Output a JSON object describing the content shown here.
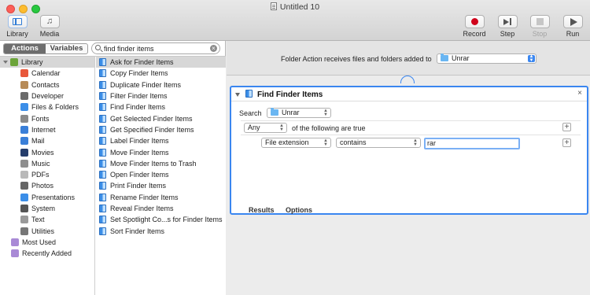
{
  "window": {
    "title": "Untitled 10"
  },
  "toolbar": {
    "library_label": "Library",
    "media_label": "Media",
    "record_label": "Record",
    "step_label": "Step",
    "stop_label": "Stop",
    "run_label": "Run"
  },
  "tabs": {
    "actions": "Actions",
    "variables": "Variables"
  },
  "search": {
    "value": "find finder items"
  },
  "library": [
    {
      "label": "Library",
      "icon": "library-icon",
      "color": "#6ca43a"
    },
    {
      "label": "Calendar",
      "icon": "calendar-icon",
      "color": "#e8583b"
    },
    {
      "label": "Contacts",
      "icon": "contacts-icon",
      "color": "#b78b57"
    },
    {
      "label": "Developer",
      "icon": "developer-icon",
      "color": "#6b6b6b"
    },
    {
      "label": "Files & Folders",
      "icon": "finder-icon",
      "color": "#3b8ee8"
    },
    {
      "label": "Fonts",
      "icon": "fonts-icon",
      "color": "#8a8a8a"
    },
    {
      "label": "Internet",
      "icon": "internet-icon",
      "color": "#3a7fd8"
    },
    {
      "label": "Mail",
      "icon": "mail-icon",
      "color": "#3a7fd8"
    },
    {
      "label": "Movies",
      "icon": "movies-icon",
      "color": "#253d6b"
    },
    {
      "label": "Music",
      "icon": "music-icon",
      "color": "#8f8f8f"
    },
    {
      "label": "PDFs",
      "icon": "pdf-icon",
      "color": "#b9b9b9"
    },
    {
      "label": "Photos",
      "icon": "photos-icon",
      "color": "#666666"
    },
    {
      "label": "Presentations",
      "icon": "presentations-icon",
      "color": "#3b8ee8"
    },
    {
      "label": "System",
      "icon": "system-icon",
      "color": "#555555"
    },
    {
      "label": "Text",
      "icon": "text-icon",
      "color": "#9a9a9a"
    },
    {
      "label": "Utilities",
      "icon": "utilities-icon",
      "color": "#777777"
    },
    {
      "label": "Most Used",
      "icon": "smart-folder-icon",
      "color": "#a98ad6"
    },
    {
      "label": "Recently Added",
      "icon": "smart-folder-icon",
      "color": "#a98ad6"
    }
  ],
  "actions": [
    "Ask for Finder Items",
    "Copy Finder Items",
    "Duplicate Finder Items",
    "Filter Finder Items",
    "Find Finder Items",
    "Get Selected Finder Items",
    "Get Specified Finder Items",
    "Label Finder Items",
    "Move Finder Items",
    "Move Finder Items to Trash",
    "Open Finder Items",
    "Print Finder Items",
    "Rename Finder Items",
    "Reveal Finder Items",
    "Set Spotlight Co...s for Finder Items",
    "Sort Finder Items"
  ],
  "workflow": {
    "folder_action_label": "Folder Action receives files and folders added to",
    "folder_action_target": "Unrar"
  },
  "action_card": {
    "title": "Find Finder Items",
    "close": "×",
    "search_label": "Search",
    "search_location": "Unrar",
    "match_mode": "Any",
    "match_text": "of the following are true",
    "criterion_field": "File extension",
    "criterion_operator": "contains",
    "criterion_value": "rar",
    "plus": "+",
    "results_tab": "Results",
    "options_tab": "Options"
  },
  "colors": {
    "accent": "#3a86f0",
    "record": "#d0021b"
  }
}
